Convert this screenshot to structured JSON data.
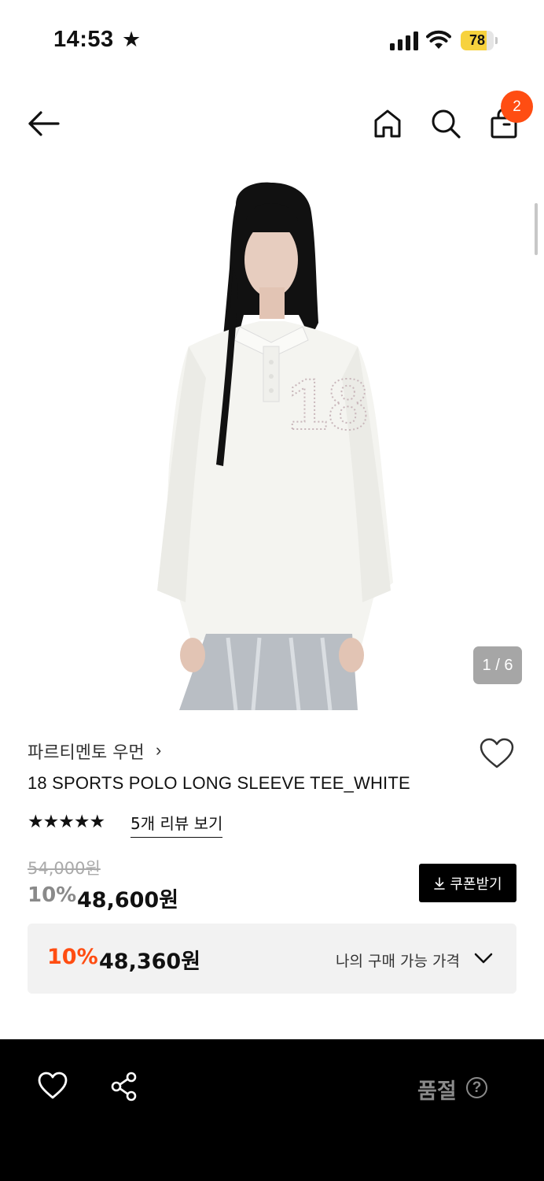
{
  "status_bar": {
    "time": "14:53",
    "battery": "78",
    "battery_level": 0.78
  },
  "header": {
    "cart_count": "2"
  },
  "gallery": {
    "counter": "1 / 6"
  },
  "product": {
    "brand": "파르티멘토 우먼",
    "brand_chevron": "›",
    "title": "18 SPORTS POLO LONG SLEEVE TEE_WHITE",
    "rating_stars": "★★★★★",
    "review_link": "5개 리뷰 보기",
    "original_price": "54,000원",
    "discount": "10%",
    "sale_price": "48,600원",
    "coupon_label": "쿠폰받기"
  },
  "my_price": {
    "discount": "10%",
    "price": "48,360원",
    "label": "나의 구매 가능 가격"
  },
  "bottom_bar": {
    "status": "품절",
    "help": "?"
  },
  "colors": {
    "accent": "#ff4d12",
    "battery": "#f7d23e"
  }
}
